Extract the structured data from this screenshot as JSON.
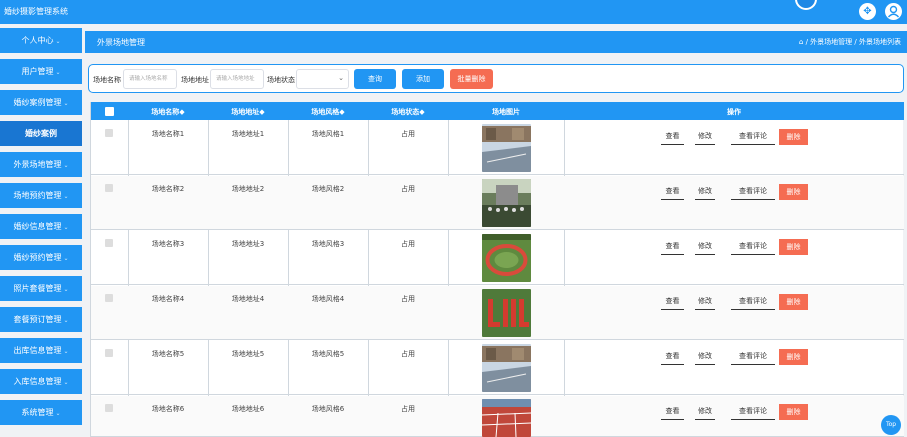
{
  "app": {
    "title": "婚纱摄影管理系统"
  },
  "header": {
    "expand_icon": "expand-icon",
    "user_icon": "user-icon"
  },
  "sidebar": {
    "items": [
      {
        "label": "个人中心",
        "type": "header"
      },
      {
        "label": "用户管理",
        "type": "item"
      },
      {
        "label": "婚纱案例管理",
        "type": "item"
      },
      {
        "label": "婚纱案例",
        "type": "active"
      },
      {
        "label": "外景场地管理",
        "type": "item"
      },
      {
        "label": "场地预约管理",
        "type": "item"
      },
      {
        "label": "婚纱信息管理",
        "type": "item"
      },
      {
        "label": "婚纱预约管理",
        "type": "item"
      },
      {
        "label": "照片套餐管理",
        "type": "item"
      },
      {
        "label": "套餐预订管理",
        "type": "item"
      },
      {
        "label": "出库信息管理",
        "type": "item"
      },
      {
        "label": "入库信息管理",
        "type": "item"
      },
      {
        "label": "系统管理",
        "type": "item"
      }
    ]
  },
  "breadcrumb": {
    "current": "外景场地管理",
    "home_icon": "home-icon",
    "path": "/ 外景场地管理 / 外景场地列表"
  },
  "search": {
    "name_label": "场地名称",
    "name_placeholder": "请输入场地名称",
    "addr_label": "场地地址",
    "addr_placeholder": "请输入场地地址",
    "status_label": "场地状态",
    "query_btn": "查询",
    "add_btn": "添加",
    "batch_delete_btn": "批量删除"
  },
  "table": {
    "columns": [
      "场地名称◆",
      "场地地址◆",
      "场地风格◆",
      "场地状态◆",
      "场地图片",
      "操作"
    ],
    "actions": {
      "view": "查看",
      "edit": "修改",
      "review": "查看评论",
      "delete": "删除"
    },
    "rows": [
      {
        "name": "场地名称1",
        "addr": "场地地址1",
        "style": "场地风格1",
        "status": "占用",
        "photo": "building-court"
      },
      {
        "name": "场地名称2",
        "addr": "场地地址2",
        "style": "场地风格2",
        "status": "占用",
        "photo": "group-photo"
      },
      {
        "name": "场地名称3",
        "addr": "场地地址3",
        "style": "场地风格3",
        "status": "占用",
        "photo": "crowd-circle"
      },
      {
        "name": "场地名称4",
        "addr": "场地地址4",
        "style": "场地风格4",
        "status": "占用",
        "photo": "red-letters"
      },
      {
        "name": "场地名称5",
        "addr": "场地地址5",
        "style": "场地风格5",
        "status": "占用",
        "photo": "building-court"
      },
      {
        "name": "场地名称6",
        "addr": "场地地址6",
        "style": "场地风格6",
        "status": "占用",
        "photo": "running-track"
      }
    ]
  },
  "fab": {
    "label": "Top"
  },
  "colors": {
    "primary": "#2196f3",
    "danger": "#f56c52"
  }
}
